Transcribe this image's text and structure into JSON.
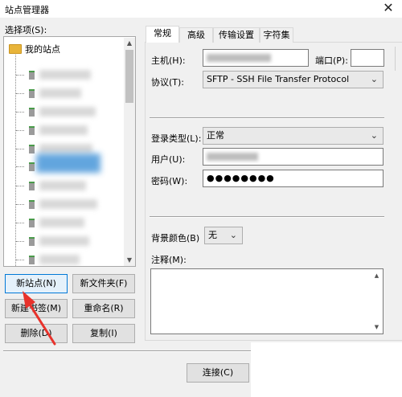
{
  "window": {
    "title": "站点管理器",
    "close_glyph": "✕"
  },
  "select_entry_label": "选择项(S):",
  "tree": {
    "root_label": "我的站点"
  },
  "buttons": {
    "new_site": "新站点(N)",
    "new_folder": "新文件夹(F)",
    "new_bookmark": "新建书签(M)",
    "rename": "重命名(R)",
    "delete": "删除(D)",
    "duplicate": "复制(I)",
    "connect": "连接(C)"
  },
  "tabs": [
    "常规",
    "高级",
    "传输设置",
    "字符集"
  ],
  "general": {
    "host_label": "主机(H):",
    "host_value_visible": "·······················",
    "port_label": "端口(P):",
    "port_value": "",
    "protocol_label": "协议(T):",
    "protocol_value": "SFTP - SSH File Transfer Protocol",
    "logon_type_label": "登录类型(L):",
    "logon_type_value": "正常",
    "user_label": "用户(U):",
    "password_label": "密码(W):",
    "password_value": "●●●●●●●●",
    "background_color_label": "背景颜色(B)",
    "background_color_value": "无",
    "comments_label": "注释(M):"
  },
  "colors": {
    "selection": "#3c8fd6",
    "annotation_arrow": "#e8322b"
  },
  "icons": [
    "close-icon",
    "folder-icon",
    "server-icon",
    "chevron-down-icon",
    "scroll-up-icon",
    "scroll-down-icon",
    "red-arrow-annotation"
  ]
}
